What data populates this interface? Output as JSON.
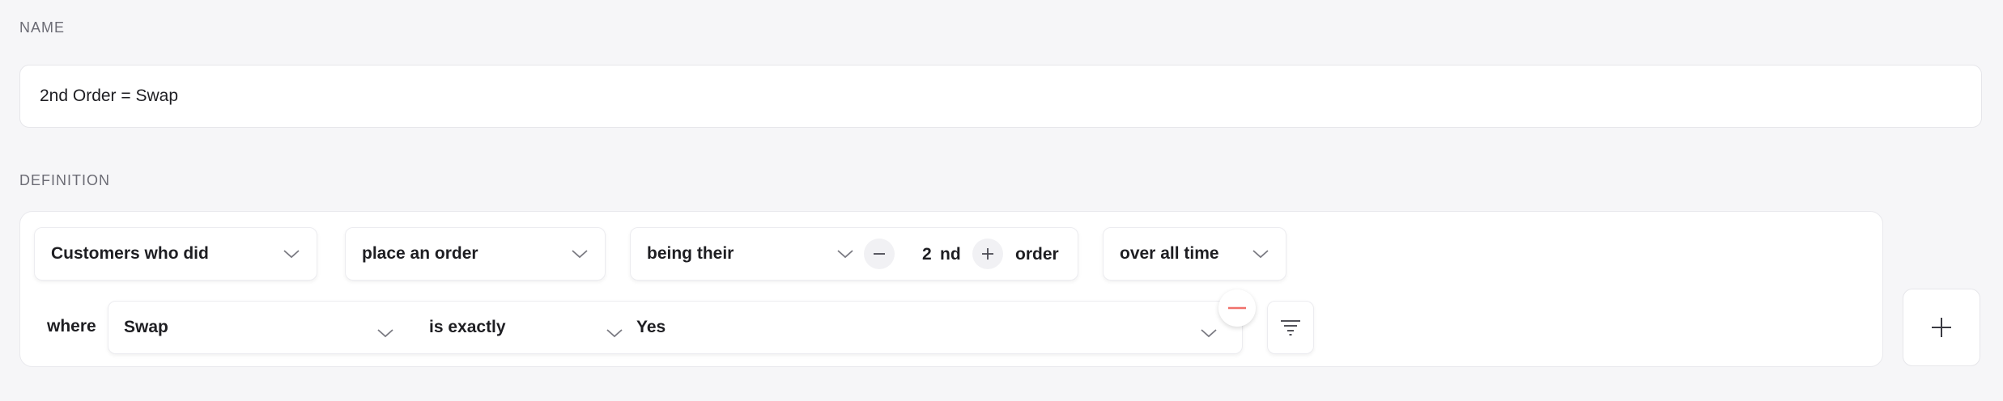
{
  "name": {
    "label": "NAME",
    "value": "2nd Order = Swap"
  },
  "definition": {
    "label": "DEFINITION",
    "subject": "Customers who did",
    "action": "place an order",
    "qualifier": "being their",
    "order_number": "2",
    "order_suffix": "nd",
    "order_word": "order",
    "timeframe": "over all time",
    "where_label": "where",
    "condition": {
      "property": "Swap",
      "operator": "is exactly",
      "value": "Yes"
    }
  },
  "colors": {
    "remove_accent": "#f0706a"
  },
  "icons": {
    "dropdown": "chevron-down-icon",
    "decrement": "minus-icon",
    "increment": "plus-icon",
    "remove": "remove-icon",
    "filter": "filter-icon",
    "add": "plus-icon"
  }
}
